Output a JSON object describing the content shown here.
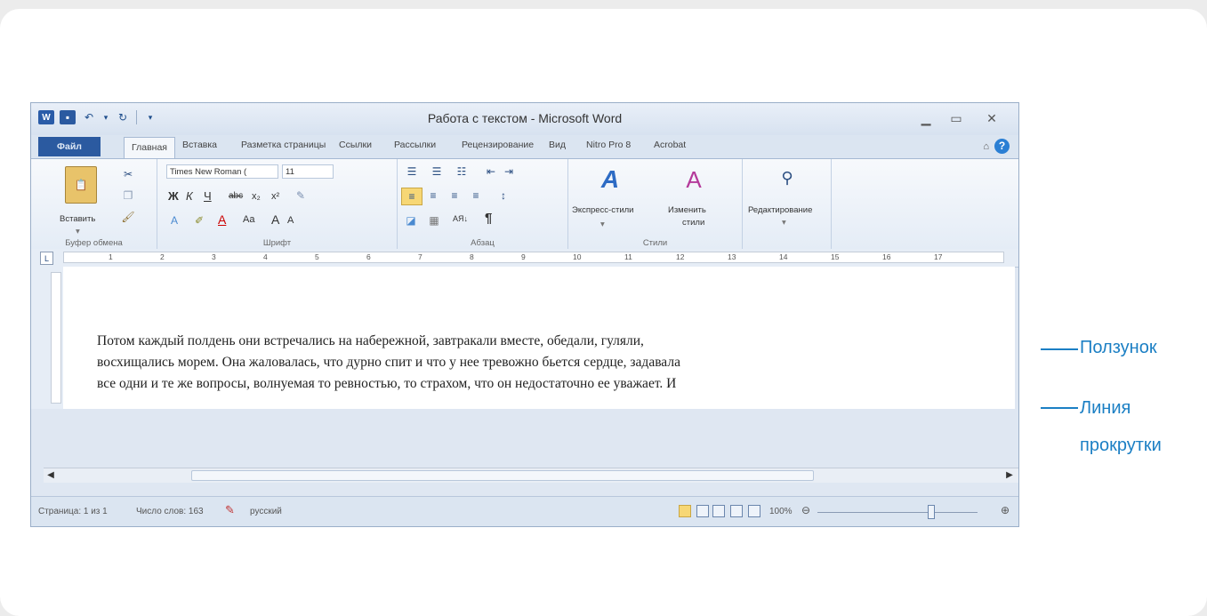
{
  "window": {
    "title": "Работа с текстом - Microsoft Word"
  },
  "qat": {
    "separator": "|"
  },
  "tabs": [
    {
      "label": "Файл"
    },
    {
      "label": "Главная"
    },
    {
      "label": "Вставка"
    },
    {
      "label": "Разметка страницы"
    },
    {
      "label": "Ссылки"
    },
    {
      "label": "Рассылки"
    },
    {
      "label": "Рецензирование"
    },
    {
      "label": "Вид"
    },
    {
      "label": "Nitro Pro 8"
    },
    {
      "label": "Acrobat"
    }
  ],
  "ribbon": {
    "clipboard": {
      "paste_label": "Вставить",
      "group_label": "Буфер обмена"
    },
    "font": {
      "font_name": "Times New Roman (",
      "font_size": "11",
      "group_label": "Шрифт",
      "bold": "Ж",
      "italic": "К",
      "underline": "Ч",
      "strike": "abc",
      "subscript": "x₂",
      "superscript": "x²",
      "case": "Aa",
      "grow": "A",
      "shrink": "A",
      "color_a": "A"
    },
    "paragraph": {
      "group_label": "Абзац",
      "sort": "АЯ↓",
      "pilcrow": "¶"
    },
    "styles": {
      "express_label": "Экспресс-стили",
      "change_label_1": "Изменить",
      "change_label_2": "стили",
      "group_label": "Стили"
    },
    "editing": {
      "label": "Редактирование"
    }
  },
  "ruler": {
    "ticks": [
      "1",
      "2",
      "3",
      "4",
      "5",
      "6",
      "7",
      "8",
      "9",
      "10",
      "11",
      "12",
      "13",
      "14",
      "15",
      "16",
      "17"
    ]
  },
  "document": {
    "lines": [
      "Потом каждый полдень они встречались на набережной, завтракали вместе, обедали, гуляли,",
      "восхищались морем. Она жаловалась, что дурно спит и что у нее тревожно бьется сердце, задавала",
      "все одни и те же вопросы, волнуемая то ревностью, то страхом, что он недостаточно ее уважает. И"
    ]
  },
  "status": {
    "page": "Страница: 1 из 1",
    "words": "Число слов: 163",
    "language": "русский",
    "zoom": "100%"
  },
  "callouts": {
    "thumb": "Ползунок",
    "scroll_line_1": "Линия",
    "scroll_line_2": "прокрутки"
  },
  "colors": {
    "accent": "#1b7fc4",
    "file_tab": "#2b5aa0"
  }
}
